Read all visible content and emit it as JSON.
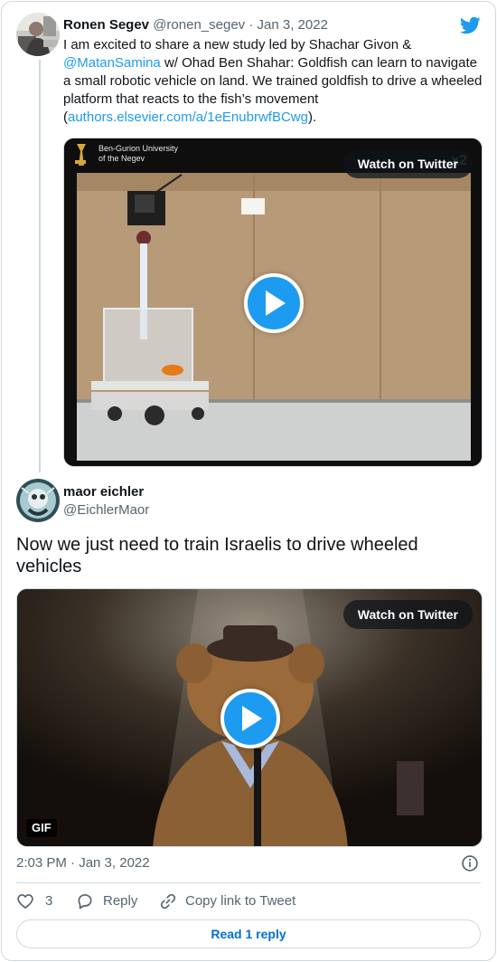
{
  "parent_tweet": {
    "author_name": "Ronen Segev",
    "author_handle": "@ronen_segev",
    "separator": "·",
    "date": "Jan 3, 2022",
    "text_part1": "I am excited to share a new study led by Shachar Givon &",
    "mention": "@MatanSamina",
    "text_part2": " w/ Ohad Ben Shahar: Goldfish can learn to navigate a small robotic vehicle on land. We trained goldfish to drive a wheeled platform that reacts to the fish’s movement",
    "link_open": "(",
    "link": "authors.elsevier.com/a/1eEnubrwfBCwg",
    "link_close": ").",
    "video": {
      "watch_label": "Watch on Twitter",
      "overlay_logo_line1": "Ben-Gurion University",
      "overlay_logo_line2": "of the Negev",
      "speed_badge": "x2"
    }
  },
  "main_tweet": {
    "author_name": "maor eichler",
    "author_handle": "@EichlerMaor",
    "text": "Now we just need to train Israelis to drive wheeled vehicles",
    "media": {
      "watch_label": "Watch on Twitter",
      "badge": "GIF"
    },
    "timestamp": "2:03 PM · Jan 3, 2022",
    "actions": {
      "like_count": "3",
      "reply_label": "Reply",
      "copy_label": "Copy link to Tweet"
    },
    "read_replies_label": "Read 1 reply"
  },
  "colors": {
    "accent": "#1d9bf0",
    "text": "#0f1419",
    "secondary_text": "#536471",
    "border": "#cfd9de"
  },
  "icons": {
    "brand": "twitter-bird-icon",
    "info": "info-icon",
    "like": "heart-icon",
    "reply": "reply-bubble-icon",
    "copy": "link-icon",
    "play": "play-icon"
  }
}
